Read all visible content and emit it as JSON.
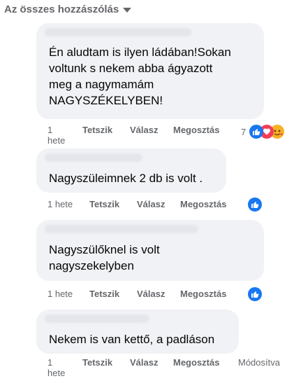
{
  "header": {
    "sort_label": "Az összes hozzászólás"
  },
  "comments": [
    {
      "text_lines": [
        "Én aludtam is ilyen ládában!Sokan",
        "voltunk s nekem abba ágyazott",
        "meg a nagymamám",
        "NAGYSZÉKELYBEN!"
      ],
      "time_line1": "1",
      "time_line2": "hete",
      "like": "Tetszik",
      "reply": "Válasz",
      "share": "Megosztás",
      "reaction_count": "7",
      "reactions": [
        "like-icon",
        "love-icon",
        "care-icon"
      ]
    },
    {
      "text_lines": [
        "Nagyszüleimnek 2 db is volt ."
      ],
      "time": "1 hete",
      "like": "Tetszik",
      "reply": "Válasz",
      "share": "Megosztás",
      "reactions": [
        "like-icon"
      ]
    },
    {
      "text_lines": [
        "Nagyszülőknel is volt",
        "nagyszekelyben"
      ],
      "time": "1 hete",
      "like": "Tetszik",
      "reply": "Válasz",
      "share": "Megosztás",
      "reactions": [
        "like-icon"
      ]
    },
    {
      "text_lines": [
        "Nekem is van kettő, a padláson"
      ],
      "time_line1": "1",
      "time_line2": "hete",
      "like": "Tetszik",
      "reply": "Válasz",
      "share": "Megosztás",
      "edit": "Módosítva"
    }
  ],
  "colors": {
    "accent": "#1877f2",
    "bubble": "#f0f2f5",
    "meta": "#65676b"
  }
}
